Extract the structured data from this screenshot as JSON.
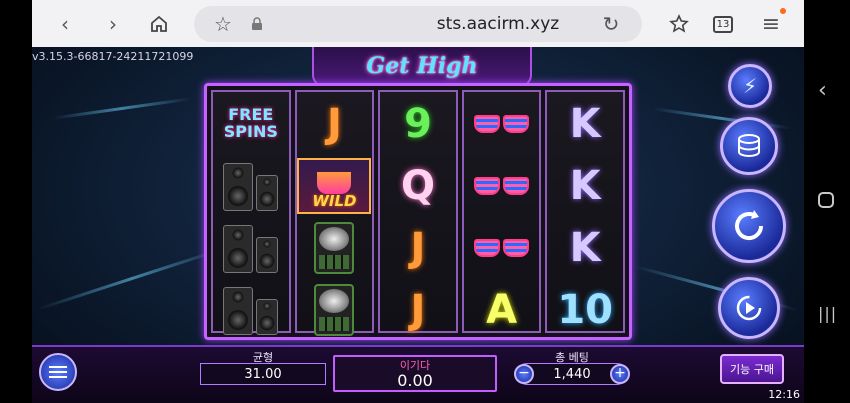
{
  "browser": {
    "url": "sts.aacirm.xyz",
    "tab_count": "13",
    "icons": [
      "back-icon",
      "forward-icon",
      "home-icon",
      "star-icon",
      "lock-icon",
      "reload-icon",
      "bookmarks-icon",
      "tabs-icon",
      "menu-icon"
    ]
  },
  "system_nav": {
    "icons": [
      "back-chevron-icon",
      "home-circle-icon",
      "recents-icon"
    ]
  },
  "game": {
    "version": "v3.15.3-66817-24211721099",
    "logo": "Get High",
    "reels": [
      [
        {
          "kind": "free",
          "line1": "FREE",
          "line2": "SPINS"
        },
        {
          "kind": "speaker"
        },
        {
          "kind": "speaker"
        },
        {
          "kind": "speaker"
        }
      ],
      [
        {
          "kind": "letter",
          "text": "J",
          "cls": "sym-j"
        },
        {
          "kind": "wild",
          "text": "WILD"
        },
        {
          "kind": "turntable"
        },
        {
          "kind": "turntable"
        }
      ],
      [
        {
          "kind": "letter",
          "text": "9",
          "cls": "sym-9"
        },
        {
          "kind": "letter",
          "text": "Q",
          "cls": "sym-q"
        },
        {
          "kind": "letter",
          "text": "J",
          "cls": "sym-j"
        },
        {
          "kind": "letter",
          "text": "J",
          "cls": "sym-j"
        }
      ],
      [
        {
          "kind": "glasses"
        },
        {
          "kind": "glasses"
        },
        {
          "kind": "glasses"
        },
        {
          "kind": "letter",
          "text": "A",
          "cls": "sym-a"
        }
      ],
      [
        {
          "kind": "letter",
          "text": "K",
          "cls": "sym-k"
        },
        {
          "kind": "letter",
          "text": "K",
          "cls": "sym-k"
        },
        {
          "kind": "letter",
          "text": "K",
          "cls": "sym-k"
        },
        {
          "kind": "letter",
          "text": "10",
          "cls": "sym-10"
        }
      ]
    ],
    "side_buttons": [
      "turbo-icon",
      "coin-stack-icon",
      "spin-icon",
      "autoplay-icon"
    ],
    "bottom": {
      "balance_label": "균형",
      "balance_value": "31.00",
      "win_label": "이기다",
      "win_value": "0.00",
      "bet_label": "총 베팅",
      "bet_value": "1,440",
      "buy_label": "기능 구매",
      "minus": "−",
      "plus": "+"
    },
    "clock": "12:16"
  }
}
